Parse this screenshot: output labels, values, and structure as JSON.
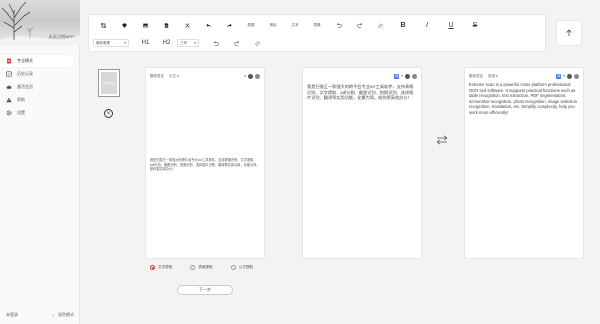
{
  "sidebar": {
    "banner_caption": "水天日明APP",
    "items": [
      {
        "label": "专业模式",
        "icon": "document-icon",
        "active": true
      },
      {
        "label": "历史记录",
        "icon": "history-icon",
        "active": false
      },
      {
        "label": "激活会员",
        "icon": "crown-icon",
        "active": false
      },
      {
        "label": "帮助",
        "icon": "warning-icon",
        "active": false
      },
      {
        "label": "设置",
        "icon": "gear-icon",
        "active": false
      }
    ],
    "footer": {
      "account": "未登录",
      "theme": "深色模式"
    }
  },
  "toolbar": {
    "row1_text_buttons": [
      "原图",
      "清除",
      "文本",
      "表格"
    ],
    "font_select": "微软雅黑",
    "size_select": "三号",
    "heading1": "H1",
    "heading2": "H2",
    "bold": "B",
    "italic": "I",
    "underline": "U",
    "strike": "S"
  },
  "thumbnail": {
    "label": "万能扫描王"
  },
  "source_panel": {
    "header_label": "翻译语言",
    "language": "中文",
    "text": "我是扫描王一款强大的跨平台专业ocr工具软件，支持表格识别、文字提取、pdf分割、截图识别、拍照识别、选择图片识别、翻译等实用功能，化繁为简，助你更高效办公！"
  },
  "middle_panel": {
    "text": "我是扫描王一款强大的跨平台专业ocr工具软件，支持表格识别、文字提取、pdf分割、截图识别、拍照识别、选择图片识别、翻译等实用功能，化繁为简，助你更高效办公！"
  },
  "translation_panel": {
    "header_label": "翻译语言",
    "language": "英语",
    "text": "Extreme scan is a powerful cross platform professional OCR tool software. It supports practical functions such as table recognition, text extraction, PDF segmentation, screenshot recognition, photo recognition, image selection recognition, translation, etc. Simplify complexity, help you work more efficiently!"
  },
  "options": {
    "radios": [
      {
        "label": "文字提取",
        "selected": true
      },
      {
        "label": "表格提取",
        "selected": false
      },
      {
        "label": "公式提取",
        "selected": false
      }
    ],
    "next_button": "下一步"
  },
  "colors": {
    "accent": "#e53935",
    "blue": "#3f7be0"
  }
}
